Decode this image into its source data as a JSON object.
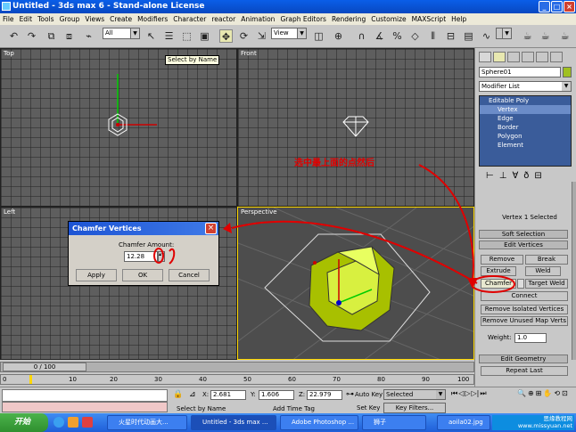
{
  "window": {
    "title": "Untitled - 3ds max 6 - Stand-alone License"
  },
  "menu": [
    "File",
    "Edit",
    "Tools",
    "Group",
    "Views",
    "Create",
    "Modifiers",
    "Character",
    "reactor",
    "Animation",
    "Graph Editors",
    "Rendering",
    "Customize",
    "MAXScript",
    "Help"
  ],
  "toolbar": {
    "filter_value": "All",
    "refcoord_value": "View",
    "tooltip": "Select by Name"
  },
  "viewports": {
    "top": "Top",
    "front": "Front",
    "left": "Left",
    "persp": "Perspective"
  },
  "annotation": "选中最上面的点然后",
  "dialog": {
    "title": "Chamfer Vertices",
    "label": "Chamfer Amount:",
    "value": "12.28",
    "apply": "Apply",
    "ok": "OK",
    "cancel": "Cancel"
  },
  "cmdpanel": {
    "object_name": "Sphere01",
    "modifier_list": "Modifier List",
    "stack": [
      "Editable Poly",
      "Vertex",
      "Edge",
      "Border",
      "Polygon",
      "Element"
    ],
    "selection_status": "Vertex 1 Selected",
    "soft_selection": "Soft Selection",
    "edit_vertices": "Edit Vertices",
    "remove": "Remove",
    "break": "Break",
    "extrude": "Extrude",
    "weld": "Weld",
    "chamfer": "Chamfer",
    "target_weld": "Target Weld",
    "connect": "Connect",
    "remove_isolated": "Remove Isolated Vertices",
    "remove_unused": "Remove Unused Map Verts",
    "weight_label": "Weight:",
    "weight_value": "1.0",
    "edit_geometry": "Edit Geometry",
    "repeat_last": "Repeat Last"
  },
  "timeline": {
    "frame": "0 / 100",
    "ticks": [
      "0",
      "10",
      "20",
      "30",
      "40",
      "50",
      "60",
      "70",
      "80",
      "90",
      "100"
    ]
  },
  "status": {
    "x_label": "X:",
    "x": "2.681",
    "y_label": "Y:",
    "y": "1.606",
    "z_label": "Z:",
    "z": "22.979",
    "autokey": "Auto Key",
    "selected": "Selected",
    "setkey": "Set Key",
    "keyfilters": "Key Filters...",
    "prompt": "Select by Name",
    "add_time_tag": "Add Time Tag"
  },
  "taskbar": {
    "start": "开始",
    "tasks": [
      "火星时代动画大...",
      "Untitled - 3ds max ...",
      "Adobe Photoshop ...",
      "狮子",
      "aoila02.jpg"
    ],
    "watermark": "思缘教程网 www.missyuan.net"
  }
}
